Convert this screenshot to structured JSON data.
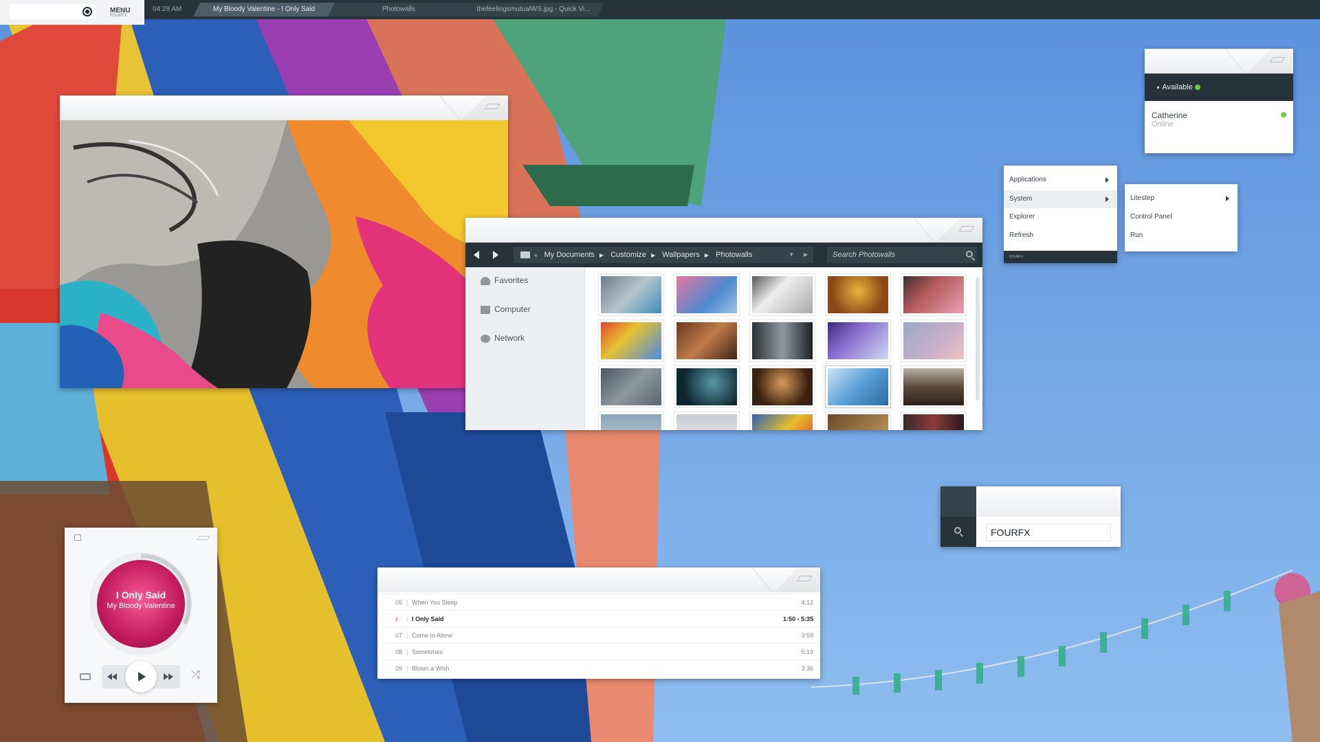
{
  "taskbar": {
    "menu_label": "MENU",
    "menu_sub": "FOURFX",
    "clock": "04:28 AM",
    "tasks": [
      {
        "label": "My Bloody Valentine - I Only Said"
      },
      {
        "label": "Photowalls"
      },
      {
        "label": "thefeelingsmutualWS.jpg - Quick Vi..."
      }
    ]
  },
  "explorer": {
    "breadcrumbs": [
      "My Documents",
      "Customize",
      "Wallpapers",
      "Photowalls"
    ],
    "search_placeholder": "Search Photowalls",
    "sidebar": [
      {
        "label": "Favorites",
        "icon": "heart-icon"
      },
      {
        "label": "Computer",
        "icon": "computer-icon"
      },
      {
        "label": "Network",
        "icon": "globe-icon"
      }
    ]
  },
  "chat": {
    "status": "Available",
    "contact_name": "Catherine",
    "contact_status": "Online"
  },
  "start_menu": {
    "items": [
      {
        "label": "Applications",
        "has_submenu": true
      },
      {
        "label": "System",
        "has_submenu": true
      },
      {
        "label": "Explorer",
        "has_submenu": false
      },
      {
        "label": "Refresh",
        "has_submenu": false
      }
    ],
    "footer": "FOURFX",
    "submenu": [
      {
        "label": "Litestep",
        "has_submenu": true
      },
      {
        "label": "Control Panel",
        "has_submenu": false
      },
      {
        "label": "Run",
        "has_submenu": false
      }
    ]
  },
  "search_widget": {
    "value": "FOURFX"
  },
  "playlist": {
    "tracks": [
      {
        "num": "05",
        "title": "When You Sleep",
        "time": "4:12"
      },
      {
        "num": "",
        "title": "I Only Said",
        "time": "1:50 - 5:35"
      },
      {
        "num": "07",
        "title": "Come In Alone",
        "time": "3:59"
      },
      {
        "num": "08",
        "title": "Sometimes",
        "time": "5:19"
      },
      {
        "num": "09",
        "title": "Blown a Wish",
        "time": "3:36"
      }
    ]
  },
  "player": {
    "title": "I Only Said",
    "artist": "My Bloody Valentine"
  },
  "colors": {
    "dark_bar": "#27333b",
    "accent_pink": "#c8275f",
    "online_green": "#6ecb3c",
    "sky": "#6fa3e0"
  }
}
